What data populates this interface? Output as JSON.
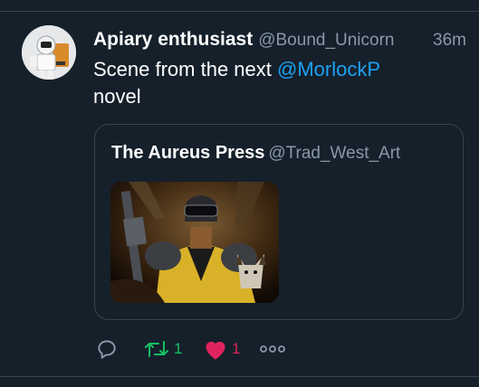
{
  "tweet": {
    "author_name": "Apiary enthusiast",
    "author_handle": "@Bound_Unicorn",
    "time": "36m",
    "text_before": "Scene from the next ",
    "mention": "@MorlockP",
    "text_after": "novel"
  },
  "quoted": {
    "author_name": "The Aureus Press",
    "author_handle": "@Trad_West_Art"
  },
  "actions": {
    "retweet_count": "1",
    "like_count": "1"
  },
  "colors": {
    "background": "#15202b",
    "secondary_text": "#8899a6",
    "link": "#1da1f2",
    "retweet": "#17bf63",
    "like": "#e0245e"
  },
  "icons": {
    "reply": "reply-icon",
    "retweet": "retweet-icon",
    "like": "heart-icon",
    "more": "more-icon"
  }
}
